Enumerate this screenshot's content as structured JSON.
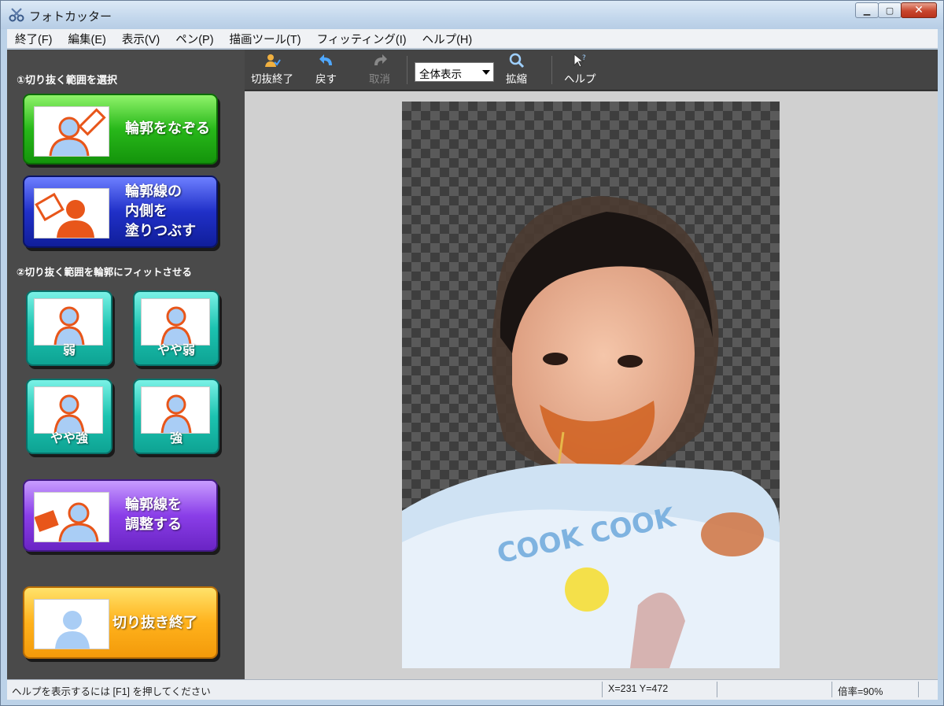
{
  "window": {
    "title": "フォトカッター"
  },
  "menu": [
    "終了(F)",
    "編集(E)",
    "表示(V)",
    "ペン(P)",
    "描画ツール(T)",
    "フィッティング(I)",
    "ヘルプ(H)"
  ],
  "panel": {
    "step1": "①切り抜く範囲を選択",
    "trace": "輪郭をなぞる",
    "fill": "輪郭線の\n内側を\n塗りつぶす",
    "step2": "②切り抜く範囲を輪郭にフィットさせる",
    "weak": "弱",
    "slightly_weak": "やや弱",
    "slightly_strong": "やや強",
    "strong": "強",
    "adjust": "輪郭線を\n調整する",
    "finish": "切り抜き終了"
  },
  "toolbar": {
    "cut_finish": "切抜終了",
    "undo": "戻す",
    "cancel": "取消",
    "zoom_value": "全体表示",
    "zoom": "拡縮",
    "help": "ヘルプ"
  },
  "status": {
    "help_hint": "ヘルプを表示するには [F1] を押してください",
    "coords": "X=231 Y=472",
    "zoom": "倍率=90%"
  }
}
